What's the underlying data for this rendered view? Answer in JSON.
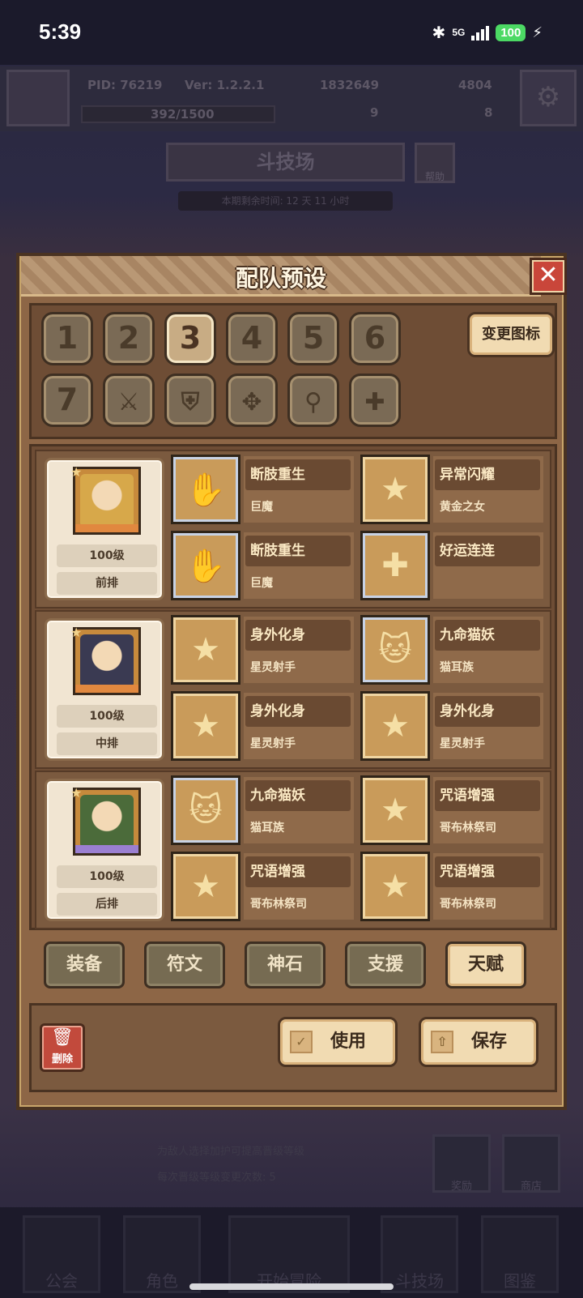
{
  "status": {
    "time": "5:39",
    "network": "5G",
    "battery": "100"
  },
  "background": {
    "pid": "PID: 76219",
    "version": "Ver: 1.2.2.1",
    "gold": "1832649",
    "gems": "4804",
    "xp": "392/1500",
    "res_a": "9",
    "res_b": "8",
    "arena_title": "斗技场",
    "help": "帮助",
    "season_time": "本期剩余时间: 12 天 11 小时",
    "tip1": "为敌人选择加护可提高晋级等级",
    "tip2": "每次晋级等级变更次数: 5",
    "reward": "奖励",
    "shop": "商店",
    "nav": [
      "公会",
      "角色",
      "开始冒险",
      "斗技场",
      "图鉴"
    ]
  },
  "dialog": {
    "title": "配队预设",
    "close_label": "✕",
    "change_icon_label": "变更图标",
    "preset_slots": [
      {
        "label": "1",
        "icon": "number-icon"
      },
      {
        "label": "2",
        "icon": "number-icon"
      },
      {
        "label": "3",
        "icon": "number-icon",
        "active": true
      },
      {
        "label": "4",
        "icon": "number-icon"
      },
      {
        "label": "5",
        "icon": "number-icon"
      },
      {
        "label": "6",
        "icon": "number-icon"
      },
      {
        "label": "7",
        "icon": "number-icon"
      },
      {
        "label": "",
        "icon": "sword-icon"
      },
      {
        "label": "",
        "icon": "shield-icon"
      },
      {
        "label": "",
        "icon": "crossbow-icon"
      },
      {
        "label": "",
        "icon": "staff-icon"
      },
      {
        "label": "",
        "icon": "cross-icon"
      }
    ],
    "teams": [
      {
        "level": "100级",
        "position": "前排",
        "portrait_color": "#d7a84a",
        "bar_color": "#e1883f",
        "skills": [
          {
            "name": "断肢重生",
            "source": "巨魔",
            "icon": "hand-icon",
            "frame": "silver"
          },
          {
            "name": "异常闪耀",
            "source": "黄金之女",
            "icon": "star-icon",
            "frame": "gold"
          },
          {
            "name": "断肢重生",
            "source": "巨魔",
            "icon": "hand-icon",
            "frame": "silver"
          },
          {
            "name": "好运连连",
            "source": "",
            "icon": "clover-icon",
            "frame": "silver"
          }
        ]
      },
      {
        "level": "100级",
        "position": "中排",
        "portrait_color": "#3a3a52",
        "bar_color": "#e1883f",
        "skills": [
          {
            "name": "身外化身",
            "source": "星灵射手",
            "icon": "star-icon",
            "frame": "gold"
          },
          {
            "name": "九命猫妖",
            "source": "猫耳族",
            "icon": "cat-icon",
            "frame": "silver"
          },
          {
            "name": "身外化身",
            "source": "星灵射手",
            "icon": "star-icon",
            "frame": "gold"
          },
          {
            "name": "身外化身",
            "source": "星灵射手",
            "icon": "star-icon",
            "frame": "gold"
          }
        ]
      },
      {
        "level": "100级",
        "position": "后排",
        "portrait_color": "#4b6b3a",
        "bar_color": "#9b7fd1",
        "skills": [
          {
            "name": "九命猫妖",
            "source": "猫耳族",
            "icon": "cat-icon",
            "frame": "silver"
          },
          {
            "name": "咒语增强",
            "source": "哥布林祭司",
            "icon": "star-icon",
            "frame": "gold"
          },
          {
            "name": "咒语增强",
            "source": "哥布林祭司",
            "icon": "star-icon",
            "frame": "gold"
          },
          {
            "name": "咒语增强",
            "source": "哥布林祭司",
            "icon": "star-icon",
            "frame": "gold"
          }
        ]
      }
    ],
    "tabs": [
      {
        "label": "装备",
        "active": false
      },
      {
        "label": "符文",
        "active": false
      },
      {
        "label": "神石",
        "active": false
      },
      {
        "label": "支援",
        "active": false
      },
      {
        "label": "天赋",
        "active": true
      }
    ],
    "delete_label": "删除",
    "use_label": "使用",
    "save_label": "保存"
  },
  "colors": {
    "dialog_bg": "#8d6646",
    "close_red": "#c9463a",
    "active_tab": "#f1dbb2"
  }
}
